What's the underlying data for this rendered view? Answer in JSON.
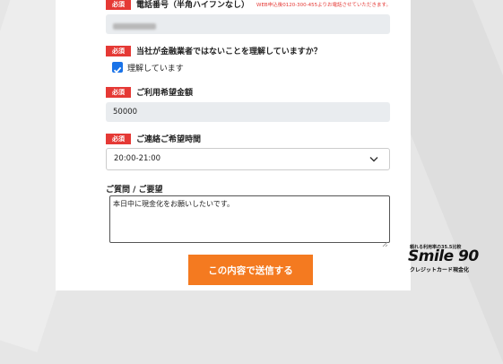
{
  "required_badge": "必須",
  "phone": {
    "label": "電話番号（半角ハイフンなし）",
    "note": "WEB申込後0120-300-455よりお電話させていただきます。"
  },
  "confirm": {
    "label": "当社が金融業者ではないことを理解していますか？",
    "checkbox_label": "理解しています",
    "checked": true
  },
  "amount": {
    "label": "ご利用希望金額",
    "value": "50000"
  },
  "contact_time": {
    "label": "ご連絡ご希望時間",
    "selected": "20:00-21:00"
  },
  "inquiry": {
    "label": "ご質問 / ご要望",
    "value": "本日中に現金化をお願いしたいです。"
  },
  "submit_label": "この内容で送信する",
  "logo": {
    "tagline": "頼れる利用率の35.5比較",
    "name": "Smile 90",
    "sub": "クレジットカード現金化"
  },
  "colors": {
    "accent": "#e53935",
    "button": "#f47a20",
    "checkbox": "#1a73e8"
  }
}
